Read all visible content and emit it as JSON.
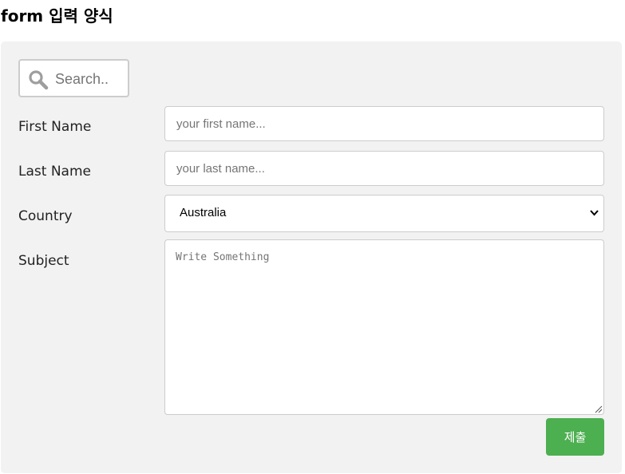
{
  "page": {
    "title": "form 입력 양식"
  },
  "search": {
    "placeholder": "Search..",
    "icon": "search-icon"
  },
  "form": {
    "first_name": {
      "label": "First Name",
      "placeholder": "your first name..."
    },
    "last_name": {
      "label": "Last Name",
      "placeholder": "your last name..."
    },
    "country": {
      "label": "Country",
      "selected": "Australia",
      "icon": "chevron-down-icon"
    },
    "subject": {
      "label": "Subject",
      "placeholder": "Write Something"
    },
    "submit_label": "제출"
  },
  "colors": {
    "container_bg": "#f2f2f2",
    "submit_bg": "#4caf50",
    "border": "#cccccc",
    "search_icon": "#9e9e9e"
  }
}
